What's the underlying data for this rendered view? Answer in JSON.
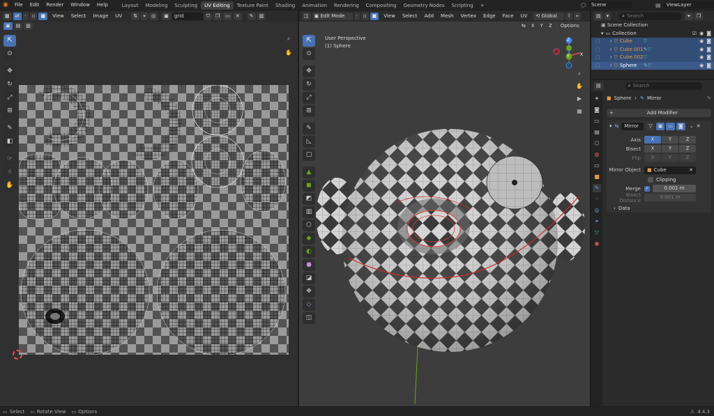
{
  "topbar": {
    "menus": [
      "File",
      "Edit",
      "Render",
      "Window",
      "Help"
    ],
    "workspaces": [
      "Layout",
      "Modeling",
      "Sculpting",
      "UV Editing",
      "Texture Paint",
      "Shading",
      "Animation",
      "Rendering",
      "Compositing",
      "Geometry Nodes",
      "Scripting"
    ],
    "active_workspace": "UV Editing",
    "add_tab": "+",
    "scene": "Scene",
    "view_layer": "ViewLayer"
  },
  "uv_editor": {
    "menus": [
      "View",
      "Select",
      "Image",
      "UV"
    ],
    "image_name": "grid"
  },
  "viewport": {
    "mode": "Edit Mode",
    "menus": [
      "View",
      "Select",
      "Add",
      "Mesh",
      "Vertex",
      "Edge",
      "Face",
      "UV"
    ],
    "transform_orientation": "Global",
    "axes": [
      "X",
      "Y",
      "Z"
    ],
    "options": "Options",
    "overlay_title": "User Perspective",
    "overlay_object": "(1) Sphere",
    "gizmo": {
      "x": "X",
      "y": "Y",
      "z": "Z"
    }
  },
  "outliner": {
    "search_placeholder": "Search",
    "scene_collection": "Scene Collection",
    "collection": "Collection",
    "objects": [
      {
        "name": "Cube",
        "color": "#e59845"
      },
      {
        "name": "Cube.001",
        "color": "#e59845"
      },
      {
        "name": "Cube.002",
        "color": "#e59845"
      },
      {
        "name": "Sphere",
        "color": "#e59845"
      }
    ]
  },
  "properties": {
    "search_placeholder": "Search",
    "breadcrumb_object": "Sphere",
    "breadcrumb_modifier": "Mirror",
    "add_modifier": "Add Modifier",
    "modifier_name": "Mirror",
    "axis_label": "Axis",
    "bisect_label": "Bisect",
    "flip_label": "Flip",
    "xyz": [
      "X",
      "Y",
      "Z"
    ],
    "mirror_object_label": "Mirror Object",
    "mirror_object_value": "Cube",
    "clipping_label": "Clipping",
    "merge_label": "Merge",
    "merge_value": "0.001 m",
    "bisect_distance_label": "Bisect Distance",
    "bisect_distance_value": "0.001 m",
    "data_label": "Data"
  },
  "statusbar": {
    "select": "Select",
    "rotate": "Rotate View",
    "options": "Options",
    "version": "4.4.3"
  },
  "colors": {
    "accent": "#4772b3",
    "object_orange": "#e59845",
    "gizmo_x": "#e8425a",
    "gizmo_y": "#6ba51e",
    "gizmo_z": "#3f84e8"
  }
}
